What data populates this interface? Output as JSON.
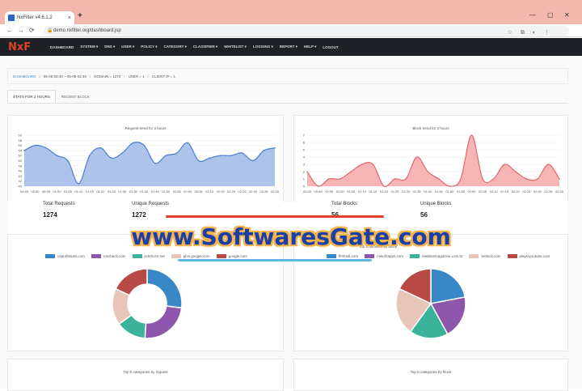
{
  "browser": {
    "tab_title": "NxFilter v4.6.1.2",
    "tab_close": "×",
    "new_tab": "+",
    "url": "demo.nxfilter.org/dashboard.jsp",
    "back": "←",
    "forward": "→",
    "reload": "⟳",
    "win_min": "—",
    "win_max": "▢",
    "win_close": "✕",
    "url_icons": "☆ ⧉ ◐ ⋮"
  },
  "app": {
    "logo": "NxF",
    "menu": [
      "DASHBOARD",
      "SYSTEM ▾",
      "DNS ▾",
      "USER ▾",
      "POLICY ▾",
      "CATEGORY ▾",
      "CLASSIFIER ▾",
      "WHITELIST ▾",
      "LOGGING ▾",
      "REPORT ▾",
      "HELP ▾",
      "LOGOUT"
    ]
  },
  "breadcrumb": {
    "link": "DASHBOARD",
    "range": "05-08 00:40 ~ 05-08 02:40",
    "domain": "DOMAIN = 1272",
    "user": "USER = 1",
    "client": "CLIENT IP = 1"
  },
  "subtabs": [
    "STATS FOR 2 HOURS",
    "RECENT BLOCK"
  ],
  "stats": {
    "total_requests_label": "Total Requests",
    "total_requests": "1274",
    "unique_requests_label": "Unique Requests",
    "unique_requests": "1272",
    "total_blocks_label": "Total Blocks",
    "total_blocks": "56",
    "unique_blocks_label": "Unique Blocks",
    "unique_blocks": "56"
  },
  "donut_right_title": "Top 5 domains by block",
  "bottom_titles": {
    "left": "Top 5 categories by request",
    "right": "Top 5 categories by block"
  },
  "watermark": "www.SoftwaresGate.com",
  "chart_data": [
    {
      "type": "area",
      "title": "Request trend for 2 hours",
      "color": "#9fb8e6",
      "stroke": "#4a7fd0",
      "x": [
        "00:45",
        "00:50",
        "00:55",
        "01:00",
        "01:05",
        "01:10",
        "01:15",
        "01:20",
        "01:25",
        "01:30",
        "01:35",
        "01:40",
        "01:45",
        "01:50",
        "01:55",
        "02:00",
        "02:05",
        "02:10",
        "02:15",
        "02:20",
        "02:25",
        "02:30",
        "02:35",
        "02:40"
      ],
      "values": [
        54,
        56,
        55,
        52,
        50,
        41,
        52,
        55,
        51,
        53,
        57,
        56,
        49,
        52,
        53,
        57,
        50,
        51,
        52,
        52,
        53,
        50,
        54,
        55
      ],
      "yticks": [
        40,
        42,
        44,
        46,
        48,
        50,
        52,
        54,
        56,
        58,
        60
      ],
      "ylim": [
        40,
        60
      ]
    },
    {
      "type": "area",
      "title": "Block trend for 2 hours",
      "color": "#f7a8a8",
      "stroke": "#e06b6b",
      "x": [
        "00:45",
        "00:50",
        "00:55",
        "01:00",
        "01:05",
        "01:10",
        "01:15",
        "01:20",
        "01:25",
        "01:30",
        "01:35",
        "01:40",
        "01:45",
        "01:50",
        "01:55",
        "02:00",
        "02:05",
        "02:10",
        "02:15",
        "02:20",
        "02:25",
        "02:30",
        "02:35",
        "02:40"
      ],
      "values": [
        2,
        0,
        1,
        1,
        2,
        3,
        3,
        0,
        1,
        1,
        4,
        2,
        1,
        0,
        1,
        7,
        1,
        1,
        3,
        2,
        1,
        1,
        3,
        1
      ],
      "yticks": [
        0,
        1,
        2,
        3,
        4,
        5,
        6,
        7
      ],
      "ylim": [
        0,
        7
      ]
    },
    {
      "type": "pie",
      "subtype": "donut",
      "title": "",
      "labels": [
        "usprofitsuss.com",
        "roscheck.com",
        "kctelcom.net",
        "plus.google.com",
        "google.com"
      ],
      "colors": [
        "#3a87c8",
        "#8e56ad",
        "#3ab39a",
        "#e9c4b8",
        "#b84a45"
      ],
      "values": [
        27,
        24,
        14,
        17,
        18
      ]
    },
    {
      "type": "pie",
      "title": "Top 5 domains by block",
      "labels": [
        "ffmhsdi.com",
        "mwuf1apps.com",
        "realtimemagazine.com.br",
        "betlock.com",
        "playtoyoutube.com"
      ],
      "colors": [
        "#3a87c8",
        "#8e56ad",
        "#3ab39a",
        "#e9c4b8",
        "#b84a45"
      ],
      "values": [
        22,
        20,
        18,
        22,
        18
      ]
    }
  ]
}
